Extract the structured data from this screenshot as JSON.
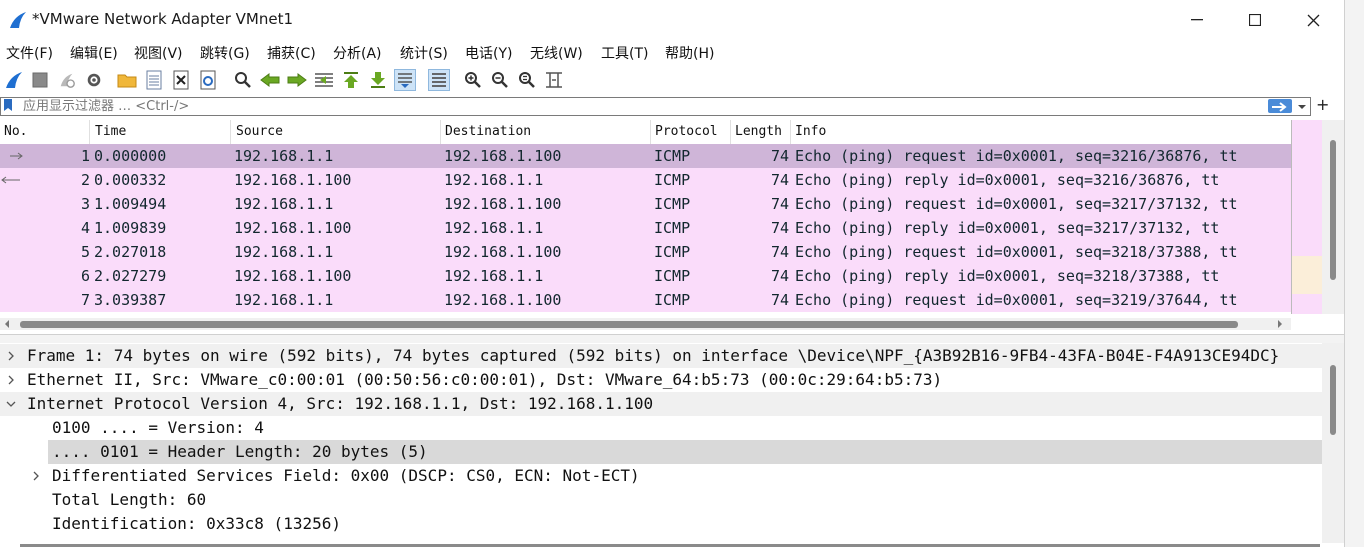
{
  "window": {
    "title": "*VMware Network Adapter VMnet1",
    "minimize": "—",
    "maximize": "☐",
    "close": "✕"
  },
  "menu": [
    "文件(F)",
    "编辑(E)",
    "视图(V)",
    "跳转(G)",
    "捕获(C)",
    "分析(A)",
    "统计(S)",
    "电话(Y)",
    "无线(W)",
    "工具(T)",
    "帮助(H)"
  ],
  "filter": {
    "placeholder": "应用显示过滤器 … <Ctrl-/>",
    "add": "+"
  },
  "columns": [
    "No.",
    "Time",
    "Source",
    "Destination",
    "Protocol",
    "Length",
    "Info"
  ],
  "packets": [
    {
      "no": "1",
      "time": "0.000000",
      "src": "192.168.1.1",
      "dst": "192.168.1.100",
      "proto": "ICMP",
      "len": "74",
      "info": "Echo (ping) request  id=0x0001, seq=3216/36876, tt"
    },
    {
      "no": "2",
      "time": "0.000332",
      "src": "192.168.1.100",
      "dst": "192.168.1.1",
      "proto": "ICMP",
      "len": "74",
      "info": "Echo (ping) reply    id=0x0001, seq=3216/36876, tt"
    },
    {
      "no": "3",
      "time": "1.009494",
      "src": "192.168.1.1",
      "dst": "192.168.1.100",
      "proto": "ICMP",
      "len": "74",
      "info": "Echo (ping) request  id=0x0001, seq=3217/37132, tt"
    },
    {
      "no": "4",
      "time": "1.009839",
      "src": "192.168.1.100",
      "dst": "192.168.1.1",
      "proto": "ICMP",
      "len": "74",
      "info": "Echo (ping) reply    id=0x0001, seq=3217/37132, tt"
    },
    {
      "no": "5",
      "time": "2.027018",
      "src": "192.168.1.1",
      "dst": "192.168.1.100",
      "proto": "ICMP",
      "len": "74",
      "info": "Echo (ping) request  id=0x0001, seq=3218/37388, tt"
    },
    {
      "no": "6",
      "time": "2.027279",
      "src": "192.168.1.100",
      "dst": "192.168.1.1",
      "proto": "ICMP",
      "len": "74",
      "info": "Echo (ping) reply    id=0x0001, seq=3218/37388, tt"
    },
    {
      "no": "7",
      "time": "3.039387",
      "src": "192.168.1.1",
      "dst": "192.168.1.100",
      "proto": "ICMP",
      "len": "74",
      "info": "Echo (ping) request  id=0x0001, seq=3219/37644, tt"
    }
  ],
  "details": [
    {
      "text": "Frame 1: 74 bytes on wire (592 bits), 74 bytes captured (592 bits) on interface \\Device\\NPF_{A3B92B16-9FB4-43FA-B04E-F4A913CE94DC}",
      "expander": "right",
      "indent": 0
    },
    {
      "text": "Ethernet II, Src: VMware_c0:00:01 (00:50:56:c0:00:01), Dst: VMware_64:b5:73 (00:0c:29:64:b5:73)",
      "expander": "right",
      "indent": 0
    },
    {
      "text": "Internet Protocol Version 4, Src: 192.168.1.1, Dst: 192.168.1.100",
      "expander": "down",
      "indent": 0
    },
    {
      "text": "0100 .... = Version: 4",
      "expander": "",
      "indent": 1
    },
    {
      "text": ".... 0101 = Header Length: 20 bytes (5)",
      "expander": "",
      "indent": 1
    },
    {
      "text": "Differentiated Services Field: 0x00 (DSCP: CS0, ECN: Not-ECT)",
      "expander": "right",
      "indent": 1
    },
    {
      "text": "Total Length: 60",
      "expander": "",
      "indent": 1
    },
    {
      "text": "Identification: 0x33c8 (13256)",
      "expander": "",
      "indent": 1
    }
  ],
  "colors": {
    "row_bg": "#fadcfa",
    "row_selected": "#cfb5d8",
    "apply_arrow": "#4a8bd8"
  },
  "toolbar_icons": [
    "shark-fin-start-icon",
    "stop-icon",
    "restart-icon",
    "options-gear-icon",
    "open-folder-icon",
    "save-file-icon",
    "close-file-icon",
    "reload-icon",
    "find-packet-icon",
    "go-back-icon",
    "go-forward-icon",
    "go-to-packet-icon",
    "go-first-icon",
    "go-last-icon",
    "autoscroll-icon",
    "colorize-icon",
    "zoom-in-icon",
    "zoom-out-icon",
    "zoom-normal-icon",
    "resize-columns-icon"
  ]
}
